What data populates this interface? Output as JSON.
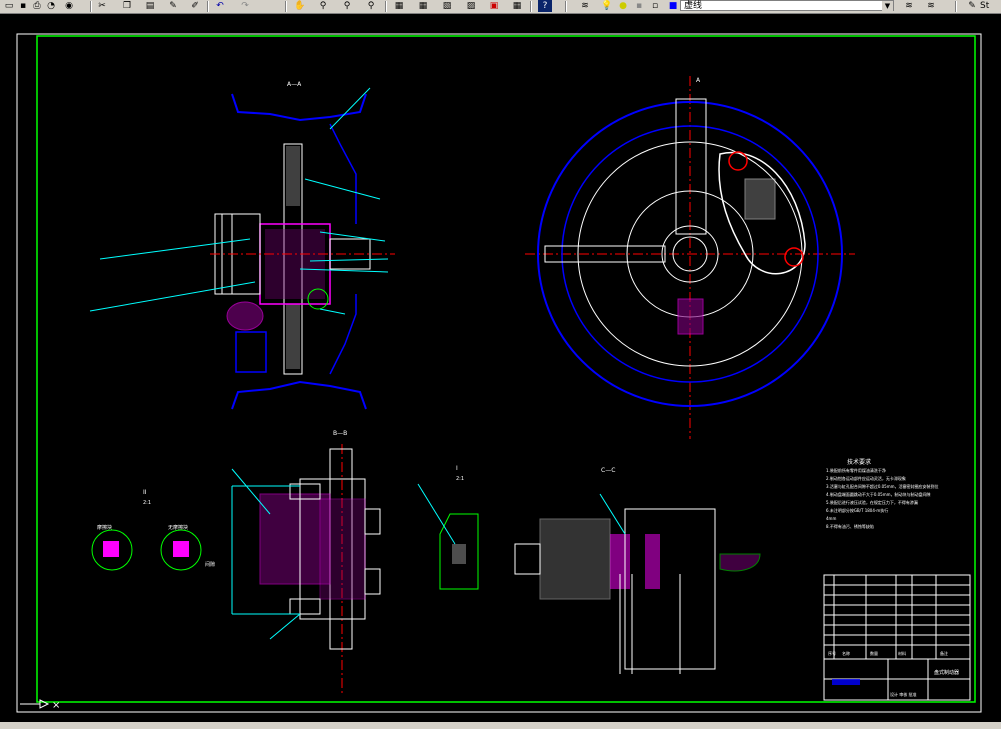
{
  "toolbar": {
    "layer_name": "虚线",
    "icons": [
      "zoom-realtime-icon",
      "pan-icon",
      "zoom-window-icon",
      "zoom-previous-icon",
      "properties-icon",
      "design-center-icon",
      "tool-palette-icon",
      "markup-icon",
      "calculator-icon",
      "help-icon",
      "layer-manager-icon",
      "layer-state-icon",
      "layer-previous-icon",
      "plot-style-icon"
    ],
    "right_text": "St"
  },
  "drawing": {
    "section_labels": {
      "top_left": "A—A",
      "top_right": "A",
      "bottom_b": "B—B",
      "bottom_c": "C—C",
      "detail_i": "I",
      "detail_ii": "II",
      "scale_i": "2:1",
      "scale_ii": "2:1"
    },
    "detail_labels": [
      "摩擦块",
      "无摩擦块",
      "间隙"
    ],
    "tech_req_title": "技术要求",
    "tech_req_lines": [
      "1.装配前所有零件用煤油清洗干净",
      "2.制动钳各运动部件应运动灵活，无卡滞现象",
      "3.活塞与缸孔配合间隙不超过0.05mm，活塞密封圈应安装到位",
      "4.制动盘端面圆跳动不大于0.05mm，制动块与制动盘间隙",
      "5.装配后进行液压试验，在规定压力下，不得有渗漏",
      "6.未注明部分按GB/T 1804-m执行",
      "4mm",
      "8.不得有油污、锈蚀等缺陷"
    ],
    "title_block": {
      "drawing_name": "盘式制动器",
      "labels": [
        "序号",
        "名称",
        "数量",
        "材料",
        "备注"
      ],
      "footer": "设计 审核 批准"
    }
  },
  "command_line": "×"
}
